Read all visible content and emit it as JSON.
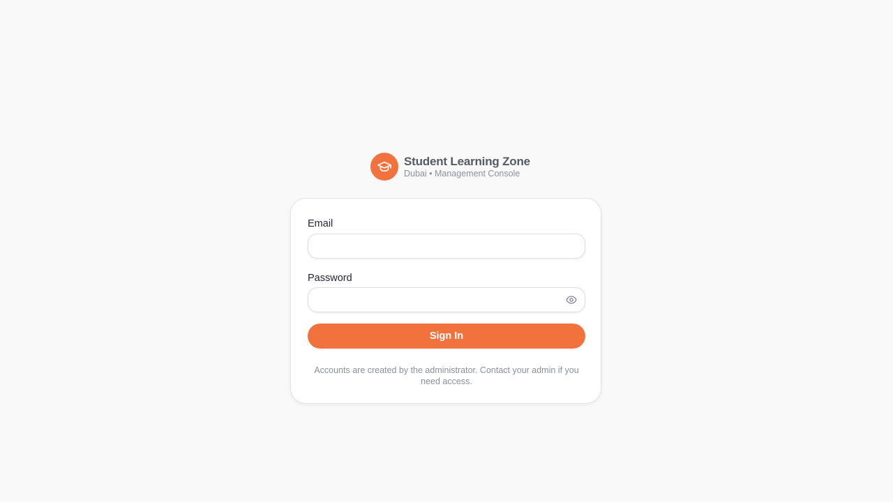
{
  "brand": {
    "logo_icon": "graduation-cap-icon",
    "title": "Student Learning Zone",
    "subtitle": "Dubai • Management Console"
  },
  "form": {
    "email": {
      "label": "Email",
      "value": "",
      "placeholder": ""
    },
    "password": {
      "label": "Password",
      "value": "",
      "placeholder": "",
      "toggle_icon": "eye-icon"
    },
    "submit_label": "Sign In",
    "help_text": "Accounts are created by the administrator. Contact your admin if you need access."
  },
  "colors": {
    "accent": "#f2723e",
    "background": "#f9f9f9",
    "card": "#ffffff",
    "muted_text": "#8a909c"
  }
}
